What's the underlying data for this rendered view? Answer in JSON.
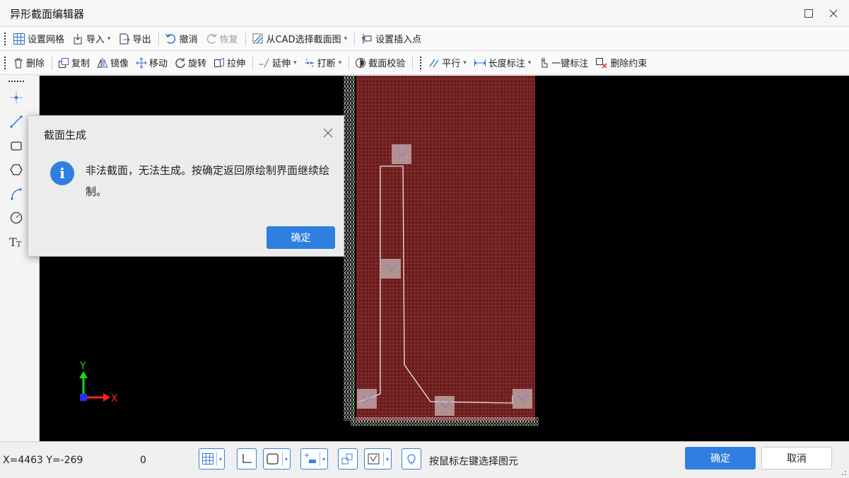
{
  "window": {
    "title": "异形截面编辑器",
    "controls": [
      "maximize-icon",
      "close-icon"
    ]
  },
  "toolbar1": {
    "grid": "设置网格",
    "import": "导入",
    "export": "导出",
    "undo": "撤消",
    "redo": "恢复",
    "from_cad": "从CAD选择截面图",
    "insert_point": "设置插入点"
  },
  "toolbar2": {
    "delete": "删除",
    "copy": "复制",
    "mirror": "镜像",
    "move": "移动",
    "rotate": "旋转",
    "stretch": "拉伸",
    "extend": "延伸",
    "break": "打断",
    "check": "截面校验",
    "parallel": "平行",
    "length_dim": "长度标注",
    "auto_dim": "一键标注",
    "delete_constraint": "删除约束"
  },
  "palette": {
    "tools": [
      "point-icon",
      "line-icon",
      "rectangle-icon",
      "polygon-icon",
      "arc-icon",
      "circle-icon",
      "text-icon"
    ]
  },
  "canvas": {
    "axis_y": "Y",
    "axis_x": "X",
    "colors": {
      "background": "#000000",
      "section_fill": "#6b1c1c",
      "grid": "#a04848",
      "outline": "#e8e8e8",
      "axis_y": "#1fd31f",
      "axis_x": "#ff2020"
    }
  },
  "dialog": {
    "title": "截面生成",
    "message": "非法截面，无法生成。按确定返回原绘制界面继续绘制。",
    "ok": "确定",
    "icon": "info-icon"
  },
  "status": {
    "coords": "X=4463 Y=-269",
    "value": "0",
    "hint": "按鼠标左键选择图元",
    "ok": "确定",
    "cancel": "取消"
  }
}
